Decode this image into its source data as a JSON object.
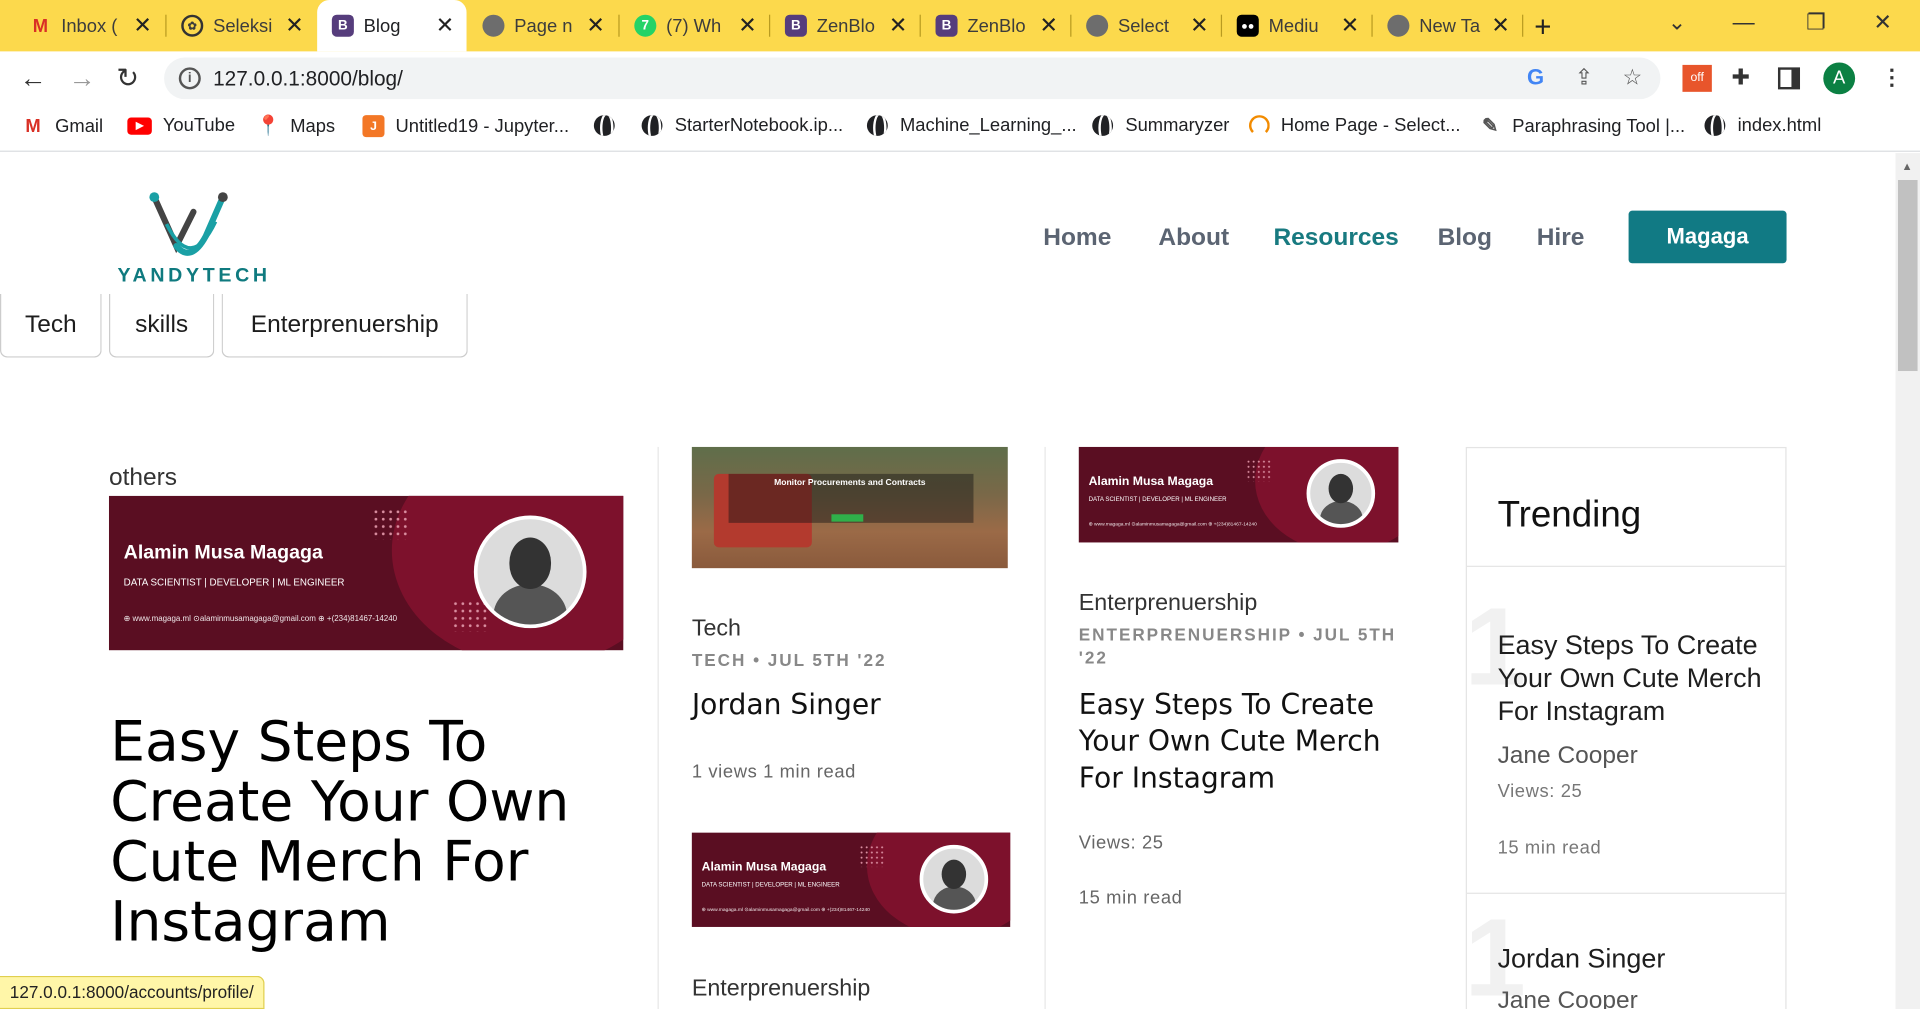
{
  "browser": {
    "tabs": [
      {
        "title": "Inbox (",
        "icon": "gmail-icon"
      },
      {
        "title": "Seleksi",
        "icon": "openai-icon"
      },
      {
        "title": "Blog",
        "icon": "bootstrap-icon"
      },
      {
        "title": "Page n",
        "icon": "chrome-icon"
      },
      {
        "title": "(7) Wh",
        "icon": "whatsapp-icon"
      },
      {
        "title": "ZenBlo",
        "icon": "bootstrap-icon"
      },
      {
        "title": "ZenBlo",
        "icon": "bootstrap-icon"
      },
      {
        "title": "Select",
        "icon": "chrome-icon"
      },
      {
        "title": "Mediu",
        "icon": "medium-icon"
      },
      {
        "title": "New Ta",
        "icon": "chrome-icon"
      }
    ],
    "url": "127.0.0.1:8000/blog/",
    "avatar": "A",
    "bookmarks": [
      {
        "label": "Gmail",
        "icon": "gmail-icon"
      },
      {
        "label": "YouTube",
        "icon": "youtube-icon"
      },
      {
        "label": "Maps",
        "icon": "maps-icon"
      },
      {
        "label": "Untitled19 - Jupyter...",
        "icon": "jupyter-icon"
      },
      {
        "label": "",
        "icon": "globe-icon"
      },
      {
        "label": "StarterNotebook.ip...",
        "icon": "globe-icon"
      },
      {
        "label": "Machine_Learning_...",
        "icon": "globe-icon"
      },
      {
        "label": "Summaryzer",
        "icon": "globe-icon"
      },
      {
        "label": "Home Page - Select...",
        "icon": "select-icon"
      },
      {
        "label": "Paraphrasing Tool |...",
        "icon": "quill-icon"
      },
      {
        "label": "index.html",
        "icon": "globe-icon"
      }
    ],
    "status_url": "127.0.0.1:8000/accounts/profile/"
  },
  "site": {
    "logo_text": "YANDYTECH",
    "nav": [
      "Home",
      "About",
      "Resources",
      "Blog",
      "Hire"
    ],
    "nav_active": "Resources",
    "cta": "Magaga",
    "chips": [
      "Tech",
      "skills",
      "Enterprenuership"
    ],
    "accent": "#117a84"
  },
  "banner": {
    "name": "Alamin Musa Magaga",
    "role": "DATA SCIENTIST | DEVELOPER | ML ENGINEER",
    "contact": "⊕ www.magaga.ml   ⊙alaminmusamagaga@gmail.com   ⊕ +(234)81467-14240",
    "color": "#5a0e22"
  },
  "featured": {
    "category": "others",
    "title": "Easy Steps To Create Your Own Cute Merch For Instagram"
  },
  "col2": {
    "thumb_text": "Monitor Procurements and Contracts",
    "category": "Tech",
    "meta": "TECH  •  JUL 5TH '22",
    "title": "Jordan Singer",
    "stats": "1 views 1 min read",
    "category2": "Enterprenuership"
  },
  "col3": {
    "category": "Enterprenuership",
    "meta_line1": "ENTERPRENUERSHIP  •  JUL 5TH",
    "meta_line2": "'22",
    "title": "Easy Steps To Create Your Own Cute Merch For Instagram",
    "views": "Views: 25",
    "read": "15 min read"
  },
  "trending": {
    "header": "Trending",
    "items": [
      {
        "num": "1",
        "title": "Easy Steps To Create Your Own Cute Merch For Instagram",
        "author": "Jane Cooper",
        "views": "Views: 25",
        "read": "15 min read"
      },
      {
        "num": "1",
        "title": "Jordan Singer",
        "author": "Jane Cooper"
      }
    ]
  }
}
